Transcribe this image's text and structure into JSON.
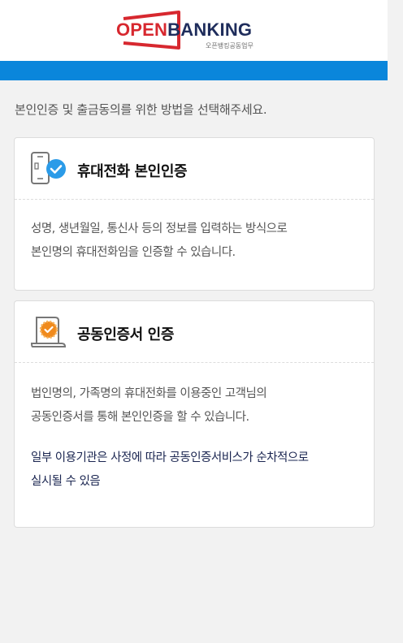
{
  "header": {
    "logo_open": "OPEN",
    "logo_banking": "BANKING",
    "logo_sub": "오픈뱅킹공동업무"
  },
  "intro": "본인인증 및 출금동의를 위한 방법을 선택해주세요.",
  "options": [
    {
      "title": "휴대전화 본인인증",
      "icon": "phone-check-icon",
      "lines": [
        "성명, 생년월일, 통신사 등의 정보를 입력하는 방식으로",
        "본인명의 휴대전화임을 인증할 수 있습니다."
      ]
    },
    {
      "title": "공동인증서 인증",
      "icon": "certificate-icon",
      "lines": [
        "법인명의, 가족명의 휴대전화를 이용중인 고객님의",
        "공동인증서를 통해 본인인증을 할 수 있습니다."
      ],
      "note_lines": [
        "일부 이용기관은 사정에 따라 공동인증서비스가 순차적으로",
        "실시될 수 있음"
      ]
    }
  ],
  "colors": {
    "brand_red": "#d7282f",
    "brand_navy": "#1f2d5c",
    "blue_bar": "#0a86db",
    "check_blue": "#2b9be8",
    "cert_orange": "#f08a1c"
  }
}
